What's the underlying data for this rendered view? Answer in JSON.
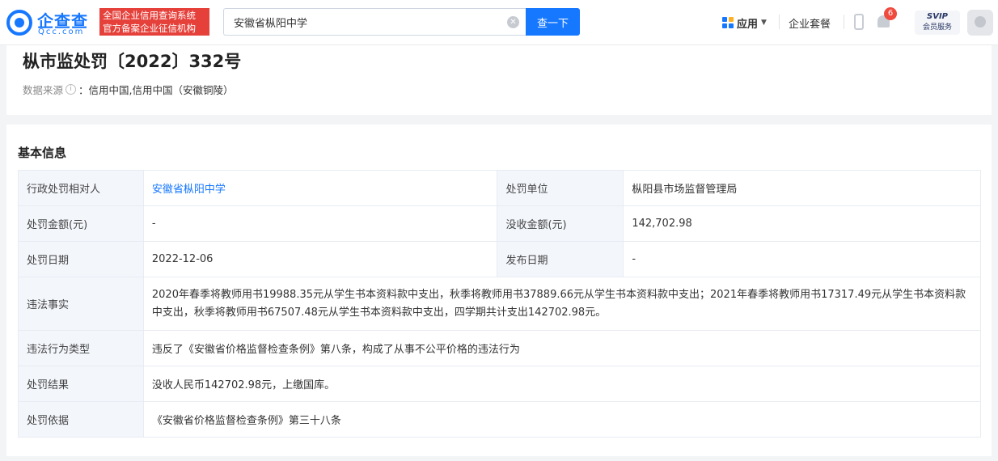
{
  "header": {
    "logo_name": "企查查",
    "logo_domain": "Qcc.com",
    "badge_line1": "全国企业信用查询系统",
    "badge_line2": "官方备案企业征信机构",
    "search_value": "安徽省枞阳中学",
    "search_button": "查一下",
    "nav_apps": "应用",
    "nav_suite": "企业套餐",
    "bell_count": "6",
    "svip_top": "SVIP",
    "svip_bottom": "会员服务"
  },
  "title_section": {
    "title": "枞市监处罚〔2022〕332号",
    "source_label": "数据来源",
    "source_sep": "：",
    "source_value": "信用中国,信用中国（安徽铜陵）"
  },
  "basic_info": {
    "section_title": "基本信息",
    "rows": [
      {
        "l1": "行政处罚相对人",
        "v1": "安徽省枞阳中学",
        "l2": "处罚单位",
        "v2": "枞阳县市场监督管理局"
      },
      {
        "l1": "处罚金额(元)",
        "v1": "-",
        "l2": "没收金额(元)",
        "v2": "142,702.98"
      },
      {
        "l1": "处罚日期",
        "v1": "2022-12-06",
        "l2": "发布日期",
        "v2": "-"
      }
    ],
    "violation_facts_label": "违法事实",
    "violation_facts": "2020年春季将教师用书19988.35元从学生书本资料款中支出，秋季将教师用书37889.66元从学生书本资料款中支出；2021年春季将教师用书17317.49元从学生书本资料款中支出，秋季将教师用书67507.48元从学生书本资料款中支出，四学期共计支出142702.98元。",
    "violation_type_label": "违法行为类型",
    "violation_type": "违反了《安徽省价格监督检查条例》第八条，构成了从事不公平价格的违法行为",
    "result_label": "处罚结果",
    "result": "没收人民币142702.98元，上缴国库。",
    "basis_label": "处罚依据",
    "basis": "《安徽省价格监督检查条例》第三十八条"
  }
}
